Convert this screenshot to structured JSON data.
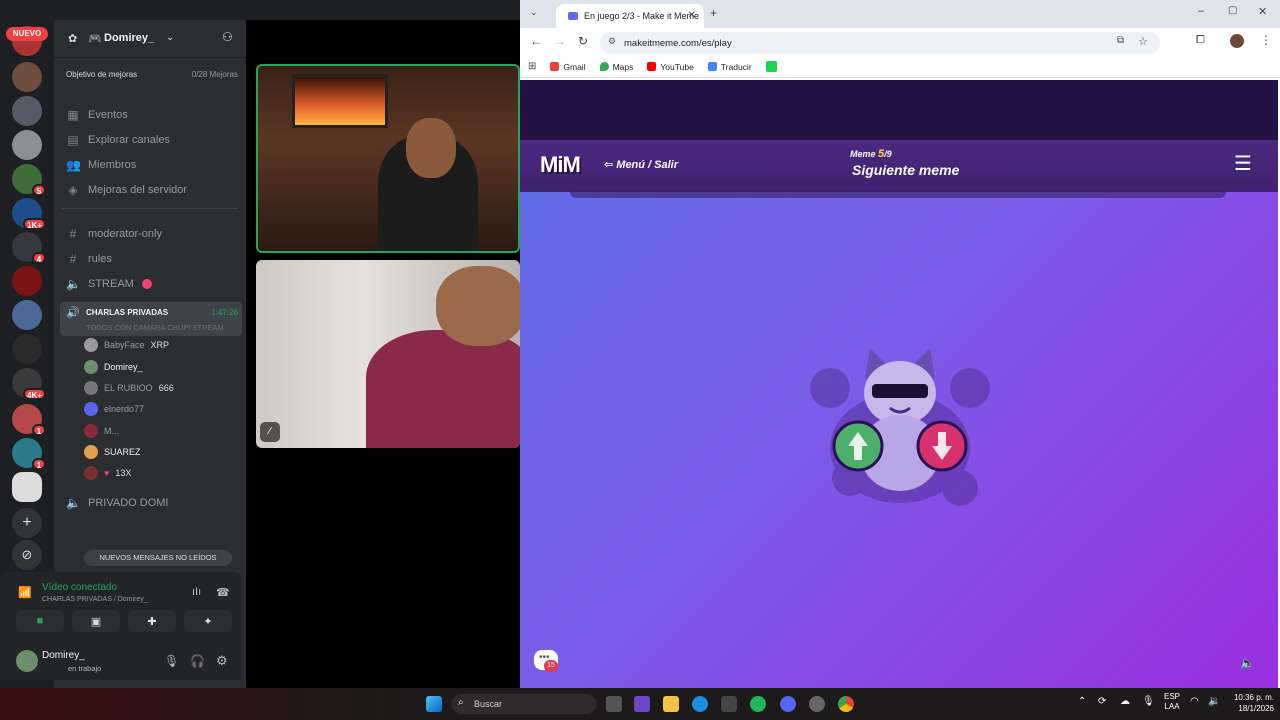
{
  "discord": {
    "nuevo_pill": "NUEVO",
    "server_name": "Domirey_",
    "boost_goal": {
      "label": "Objetivo de mejoras",
      "progress": "0/28 Mejoras"
    },
    "menu_items": [
      {
        "label": "Eventos",
        "icon": "calendar-icon"
      },
      {
        "label": "Explorar canales",
        "icon": "browse-icon"
      },
      {
        "label": "Miembros",
        "icon": "members-icon"
      },
      {
        "label": "Mejoras del servidor",
        "icon": "boost-icon"
      }
    ],
    "text_channels": [
      {
        "label": "moderator-only"
      },
      {
        "label": "rules"
      }
    ],
    "stream_channel": "STREAM",
    "voice_channel": {
      "name": "CHARLAS PRIVADAS",
      "timer": "1:47:26",
      "status": "TODOS CON CAMARA CHUPI STREAM"
    },
    "voice_users": [
      {
        "name": "BabyFace",
        "tag": "XRP",
        "color": "#9a9a9a"
      },
      {
        "name": "Domirey_",
        "tag": "",
        "color": "#6b8f6b"
      },
      {
        "name": "EL RUBIOO",
        "tag": "666",
        "color": "#777777"
      },
      {
        "name": "elnerdo77",
        "tag": "",
        "color": "#5865f2"
      },
      {
        "name": "M...",
        "tag": "",
        "color": "#8b2a3a"
      },
      {
        "name": "SUAREZ",
        "tag": "",
        "color": "#e0a050"
      },
      {
        "name": "",
        "tag": "13X",
        "color": "#7a3030"
      }
    ],
    "private_channel": "PRIVADO DOMI",
    "unread_pill": "NUEVOS MENSAJES NO LEÍDOS",
    "connection": {
      "title": "Vídeo conectado",
      "subtitle": "CHARLAS PRIVADAS / Domirey_"
    },
    "user": {
      "name": "Domirey_",
      "status": "en trabajo"
    },
    "server_badges": [
      "5",
      "1K+",
      "4",
      "4K+",
      "1",
      "1"
    ]
  },
  "browser": {
    "tab_title": "En juego 2/3 - Make it Meme",
    "url": "makeitmeme.com/es/play",
    "bookmarks": [
      "Gmail",
      "Maps",
      "YouTube",
      "Traducir"
    ],
    "game": {
      "logo": "MiM",
      "menu_link": "Menú / Salir",
      "meme_label": "Meme",
      "meme_current": "5",
      "meme_total": "/9",
      "heading": "Siguiente meme",
      "chat_badge": "15"
    }
  },
  "taskbar": {
    "search_placeholder": "Buscar",
    "lang": "ESP",
    "lang_sub": "LAA",
    "time": "10:36 p. m.",
    "date": "18/1/2026"
  }
}
